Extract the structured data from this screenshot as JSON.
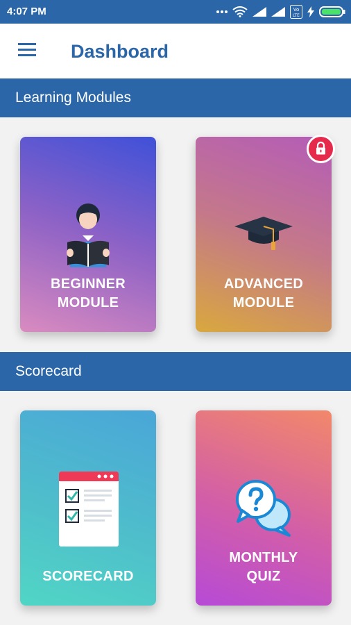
{
  "status_bar": {
    "time": "4:07 PM",
    "icons": [
      "more-dots-icon",
      "wifi-icon",
      "signal-icon",
      "signal-icon",
      "volte-icon",
      "charging-icon",
      "battery-icon"
    ],
    "volte_text": "Vo LTE"
  },
  "app_bar": {
    "title": "Dashboard",
    "menu_icon": "hamburger-menu-icon"
  },
  "sections": [
    {
      "title": "Learning Modules",
      "cards": [
        {
          "label_line1": "BEGINNER",
          "label_line2": "MODULE",
          "icon": "student-reading-icon",
          "locked": false
        },
        {
          "label_line1": "ADVANCED",
          "label_line2": "MODULE",
          "icon": "graduation-cap-icon",
          "locked": true
        }
      ]
    },
    {
      "title": "Scorecard",
      "cards": [
        {
          "label_line1": "SCORECARD",
          "label_line2": "",
          "icon": "checklist-icon",
          "locked": false
        },
        {
          "label_line1": "MONTHLY",
          "label_line2": "QUIZ",
          "icon": "question-chat-icon",
          "locked": false
        }
      ]
    }
  ],
  "colors": {
    "primary": "#2b66a8",
    "lock_badge": "#e62a4c",
    "background": "#f2f2f2"
  }
}
